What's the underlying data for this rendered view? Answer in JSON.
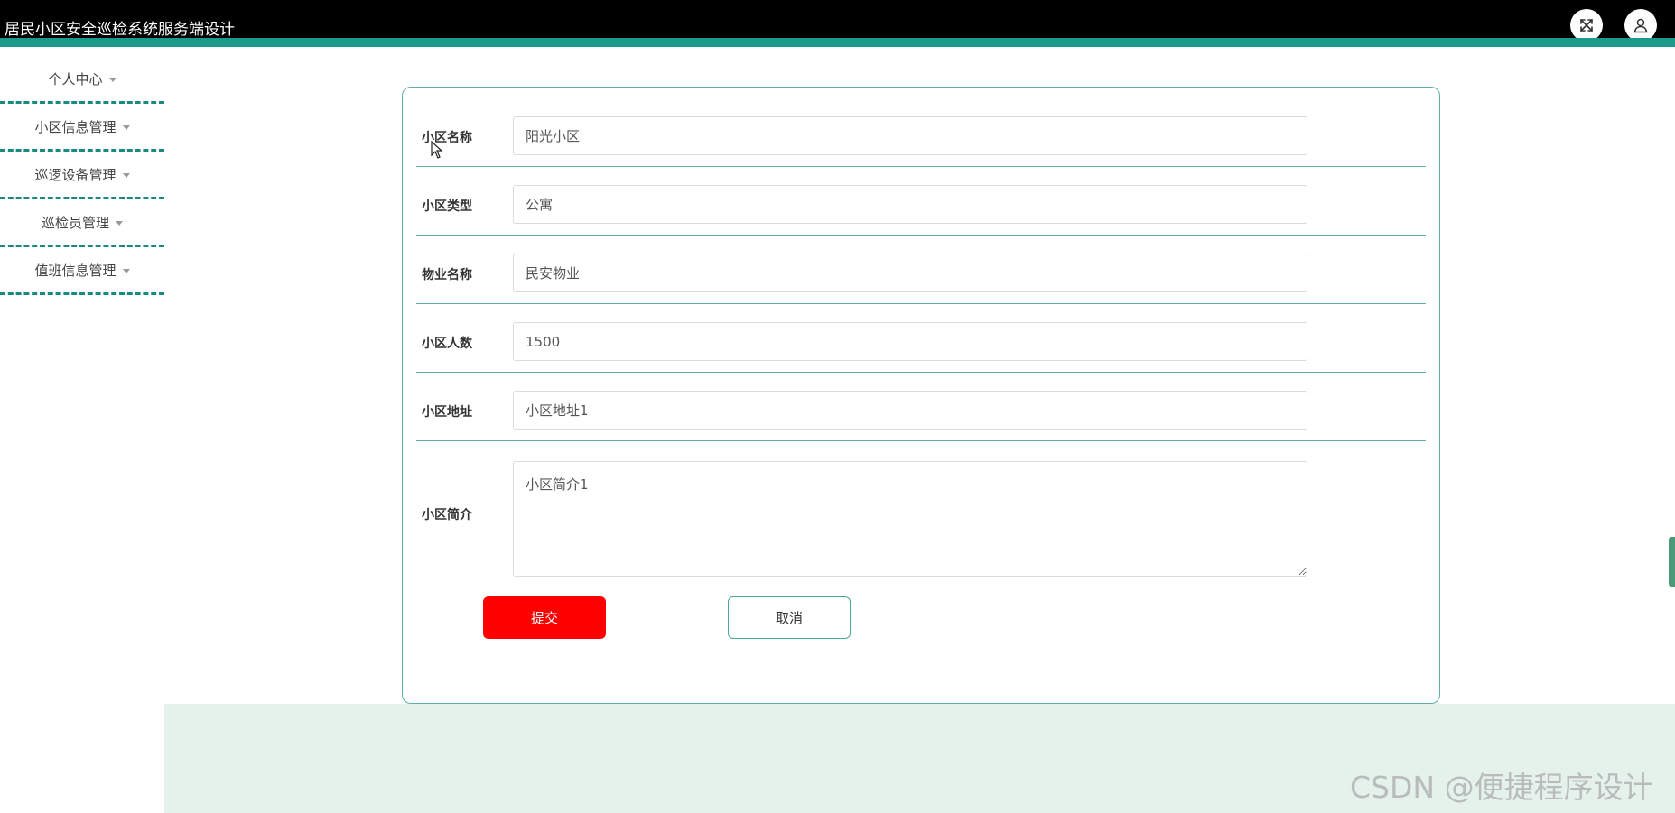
{
  "app": {
    "title": "居民小区安全巡检系统服务端设计",
    "fullscreen_icon": "expand-arrows-icon",
    "user_icon": "user-avatar-icon",
    "accent_color": "#1a9a8a"
  },
  "sidebar": {
    "items": [
      {
        "label": "个人中心"
      },
      {
        "label": "小区信息管理"
      },
      {
        "label": "巡逻设备管理"
      },
      {
        "label": "巡检员管理"
      },
      {
        "label": "值班信息管理"
      }
    ]
  },
  "form": {
    "fields": [
      {
        "label": "小区名称",
        "value": "阳光小区"
      },
      {
        "label": "小区类型",
        "value": "公寓"
      },
      {
        "label": "物业名称",
        "value": "民安物业"
      },
      {
        "label": "小区人数",
        "value": "1500"
      },
      {
        "label": "小区地址",
        "value": "小区地址1"
      },
      {
        "label": "小区简介",
        "value": "小区简介1"
      }
    ],
    "submit_label": "提交",
    "cancel_label": "取消",
    "submit_color": "#ff0000"
  },
  "watermark": "CSDN @便捷程序设计"
}
